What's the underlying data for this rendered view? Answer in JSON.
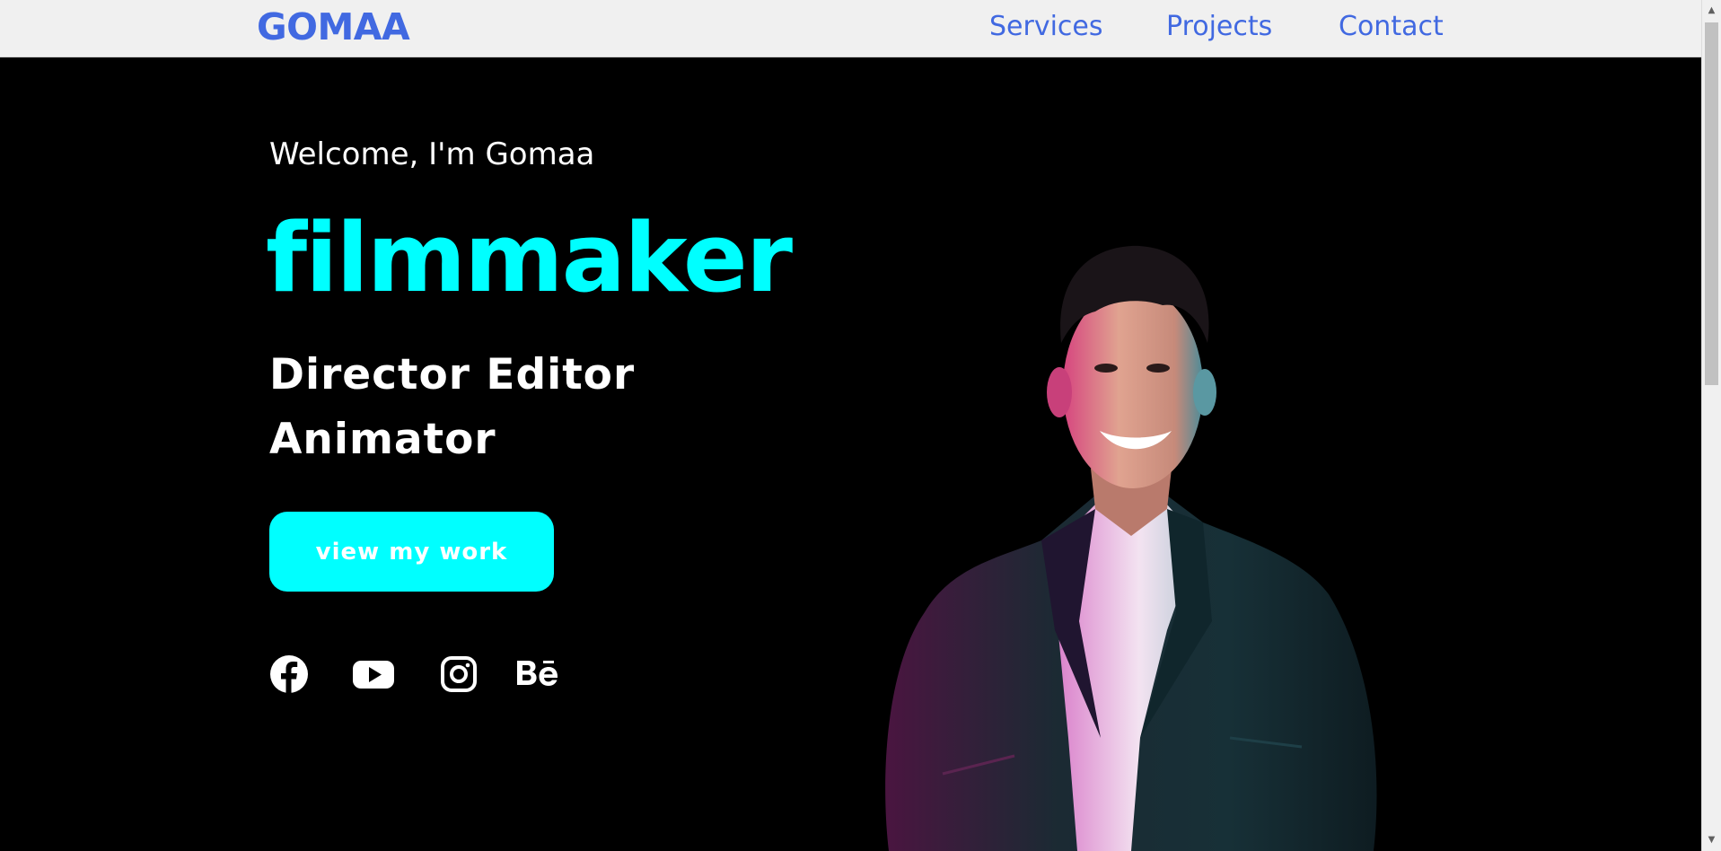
{
  "navbar": {
    "logo": "GOMAA",
    "links": [
      "Services",
      "Projects",
      "Contact"
    ]
  },
  "hero": {
    "greeting": "Welcome, I'm Gomaa",
    "headline": "filmmaker",
    "roles_line1": "Director Editor",
    "roles_line2": "Animator",
    "cta_label": "view my work"
  },
  "socials": [
    {
      "icon": "facebook-icon"
    },
    {
      "icon": "youtube-icon"
    },
    {
      "icon": "instagram-icon"
    },
    {
      "icon": "behance-icon"
    }
  ],
  "colors": {
    "accent": "#00ffff",
    "nav_link": "#4169e1",
    "background": "#000000",
    "navbar_bg": "#f0f0f0"
  }
}
